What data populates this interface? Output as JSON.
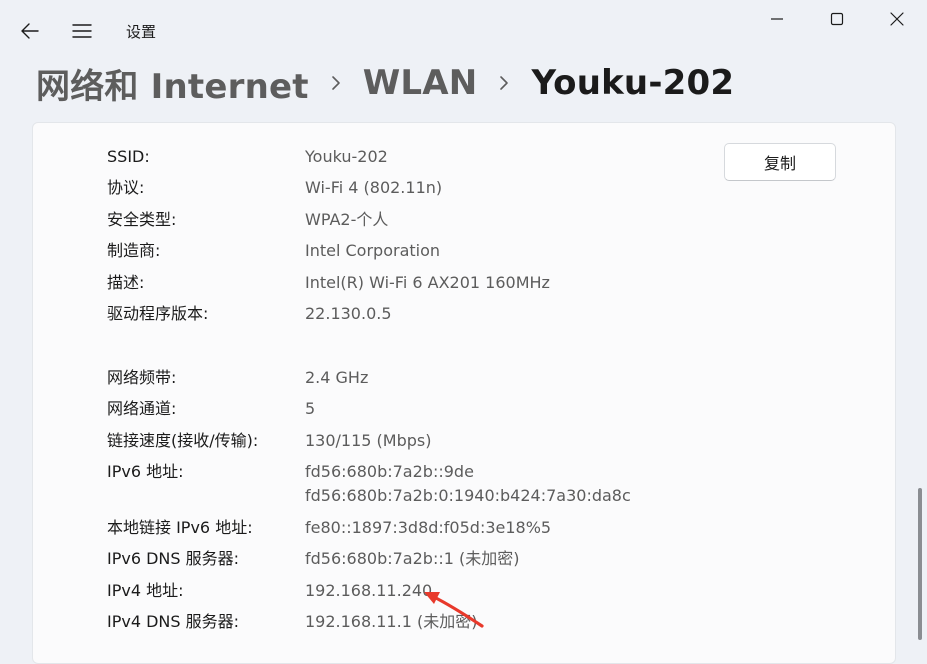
{
  "app": {
    "title": "设置"
  },
  "breadcrumb": {
    "items": [
      "网络和 Internet",
      "WLAN",
      "Youku-202"
    ]
  },
  "actions": {
    "copy_label": "复制"
  },
  "properties": [
    {
      "label": "SSID:",
      "value": "Youku-202"
    },
    {
      "label": "协议:",
      "value": "Wi-Fi 4 (802.11n)"
    },
    {
      "label": "安全类型:",
      "value": "WPA2-个人"
    },
    {
      "label": "制造商:",
      "value": "Intel Corporation"
    },
    {
      "label": "描述:",
      "value": "Intel(R) Wi-Fi 6 AX201 160MHz"
    },
    {
      "label": "驱动程序版本:",
      "value": "22.130.0.5"
    },
    {
      "label": "网络频带:",
      "value": "2.4 GHz"
    },
    {
      "label": "网络通道:",
      "value": "5"
    },
    {
      "label": "链接速度(接收/传输):",
      "value": "130/115 (Mbps)"
    },
    {
      "label": "IPv6 地址:",
      "value": "fd56:680b:7a2b::9de",
      "value2": "fd56:680b:7a2b:0:1940:b424:7a30:da8c"
    },
    {
      "label": "本地链接 IPv6 地址:",
      "value": "fe80::1897:3d8d:f05d:3e18%5"
    },
    {
      "label": "IPv6 DNS 服务器:",
      "value": "fd56:680b:7a2b::1 (未加密)"
    },
    {
      "label": "IPv4 地址:",
      "value": "192.168.11.240"
    },
    {
      "label": "IPv4 DNS 服务器:",
      "value": "192.168.11.1 (未加密)"
    }
  ],
  "colors": {
    "annotation_arrow": "#e8392b",
    "background": "#eef1f6",
    "card": "#fbfbfc"
  },
  "icons": {
    "back": "arrow-left-icon",
    "menu": "hamburger-menu-icon",
    "minimize": "minimize-icon",
    "maximize": "maximize-icon",
    "close": "close-icon",
    "breadcrumb_separator": "chevron-right-icon"
  }
}
